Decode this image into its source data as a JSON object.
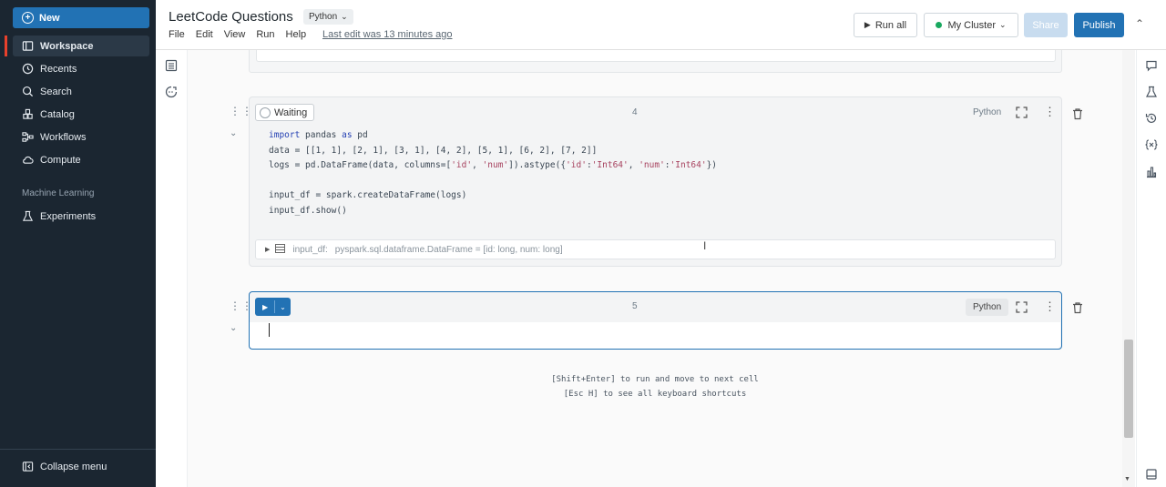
{
  "sidebar": {
    "new_label": "New",
    "items": [
      {
        "label": "Workspace",
        "icon": "workspace-icon",
        "active": true
      },
      {
        "label": "Recents",
        "icon": "clock-icon"
      },
      {
        "label": "Search",
        "icon": "search-icon"
      },
      {
        "label": "Catalog",
        "icon": "catalog-icon"
      },
      {
        "label": "Workflows",
        "icon": "workflows-icon"
      },
      {
        "label": "Compute",
        "icon": "cloud-icon"
      }
    ],
    "section_ml": "Machine Learning",
    "ml_items": [
      {
        "label": "Experiments",
        "icon": "flask-icon"
      }
    ],
    "collapse_label": "Collapse menu"
  },
  "header": {
    "title": "LeetCode Questions",
    "language": "Python",
    "menu": [
      "File",
      "Edit",
      "View",
      "Run",
      "Help"
    ],
    "last_edit": "Last edit was 13 minutes ago",
    "run_all": "Run all",
    "cluster": "My Cluster",
    "share": "Share",
    "publish": "Publish"
  },
  "cells": {
    "c4": {
      "status": "Waiting",
      "number": "4",
      "language": "Python",
      "code": {
        "l1a": "import",
        "l1b": " pandas ",
        "l1c": "as",
        "l1d": " pd",
        "l2": "data = [[1, 1], [2, 1], [3, 1], [4, 2], [5, 1], [6, 2], [7, 2]]",
        "l3a": "logs = pd.DataFrame(data, columns=[",
        "l3b": "'id'",
        "l3c": ", ",
        "l3d": "'num'",
        "l3e": "]).astype({",
        "l3f": "'id'",
        "l3g": ":",
        "l3h": "'Int64'",
        "l3i": ", ",
        "l3j": "'num'",
        "l3k": ":",
        "l3l": "'Int64'",
        "l3m": "})",
        "l4": "input_df = spark.createDataFrame(logs)",
        "l5": "input_df.show()"
      },
      "output": {
        "var": "input_df:",
        "type": "pyspark.sql.dataframe.DataFrame = [id: long, num: long]"
      }
    },
    "c5": {
      "number": "5",
      "language": "Python"
    }
  },
  "hints": {
    "run": "[Shift+Enter] to run and move to next cell",
    "shortcuts": "[Esc H] to see all keyboard shortcuts"
  },
  "colors": {
    "sidebar_bg": "#1b2631",
    "accent": "#2272b4",
    "active_marker": "#e8412c",
    "cluster_status": "#19a85f"
  }
}
